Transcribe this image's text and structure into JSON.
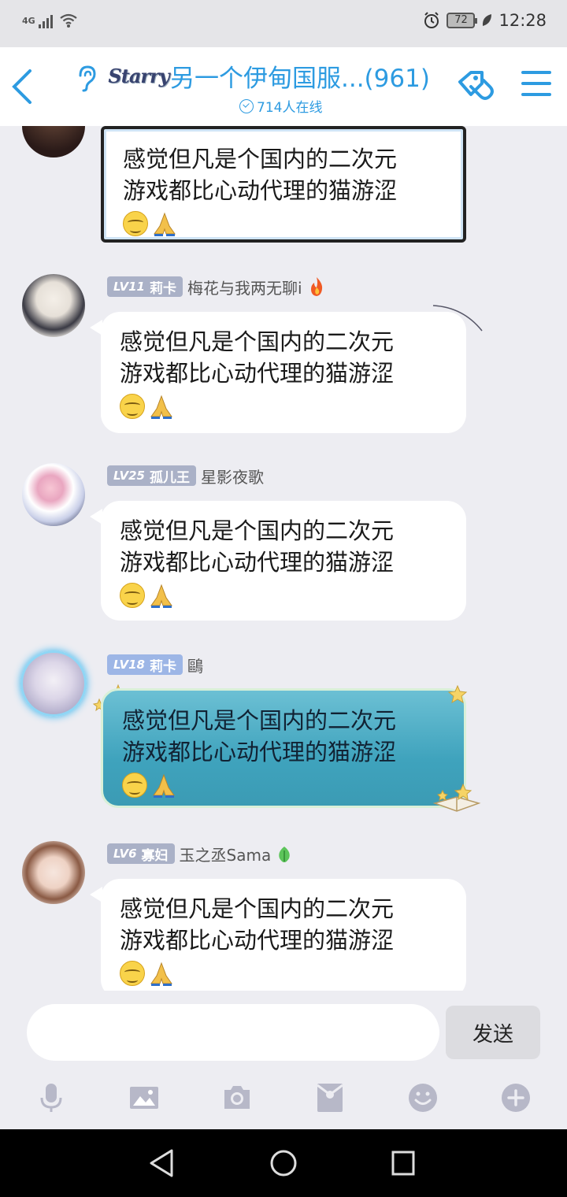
{
  "status_bar": {
    "network": "4G",
    "battery": "72",
    "time": "12:28"
  },
  "header": {
    "logo_text": "Starry",
    "title": "另一个伊甸国服...(961)",
    "online": "714人在线"
  },
  "messages": [
    {
      "text_line1": "感觉但凡是个国内的二次元",
      "text_line2": "游戏都比心动代理的猫游涩"
    },
    {
      "level": "LV11",
      "title": "莉卡",
      "nick": "梅花与我两无聊i",
      "text_line1": "感觉但凡是个国内的二次元",
      "text_line2": "游戏都比心动代理的猫游涩"
    },
    {
      "level": "LV25",
      "title": "孤儿王",
      "nick": "星影夜歌",
      "text_line1": "感觉但凡是个国内的二次元",
      "text_line2": "游戏都比心动代理的猫游涩"
    },
    {
      "level": "LV18",
      "title": "莉卡",
      "nick": "鷗",
      "text_line1": "感觉但凡是个国内的二次元",
      "text_line2": "游戏都比心动代理的猫游涩"
    },
    {
      "level": "LV6",
      "title": "寡妇",
      "nick": "玉之丞Sama",
      "text_line1": "感觉但凡是个国内的二次元",
      "text_line2": "游戏都比心动代理的猫游涩"
    }
  ],
  "input": {
    "send_label": "发送"
  },
  "colors": {
    "accent": "#2d9be1",
    "background": "#ededf2",
    "level_badge": "#aab1c7"
  }
}
